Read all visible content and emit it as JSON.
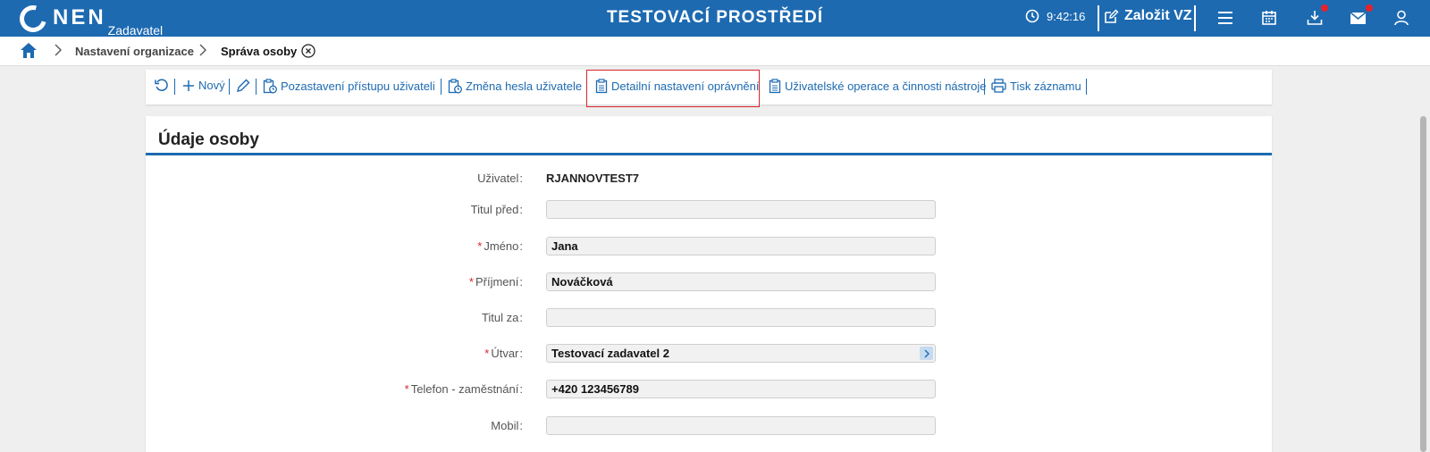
{
  "header": {
    "logo_text": "NEN",
    "logo_sub": "Zadavatel",
    "env_title": "TESTOVACÍ PROSTŘEDÍ",
    "time": "9:42:16",
    "create_label": "Založit VZ",
    "accent_color": "#1d6ab1",
    "badge_color": "#e8212b"
  },
  "breadcrumb": {
    "items": [
      "Nastavení organizace",
      "Správa osoby"
    ]
  },
  "toolbar": {
    "new_label": "Nový",
    "suspend_label": "Pozastavení přístupu uživateli",
    "change_pwd_label": "Změna hesla uživatele",
    "detail_perm_label": "Detailní nastavení oprávnění",
    "user_ops_label": "Uživatelské operace a činnosti nástroje",
    "print_label": "Tisk záznamu"
  },
  "card": {
    "title": "Údaje osoby",
    "fields": [
      {
        "label": "Uživatel",
        "value": "RJANNOVTEST7",
        "required": false
      },
      {
        "label": "Titul před",
        "value": "",
        "required": false
      },
      {
        "label": "Jméno",
        "value": "Jana",
        "required": true
      },
      {
        "label": "Příjmení",
        "value": "Nováčková",
        "required": true
      },
      {
        "label": "Titul za",
        "value": "",
        "required": false
      },
      {
        "label": "Útvar",
        "value": "Testovací zadavatel 2",
        "required": true
      },
      {
        "label": "Telefon - zaměstnání",
        "value": "+420 123456789",
        "required": true
      },
      {
        "label": "Mobil",
        "value": "",
        "required": false
      }
    ]
  }
}
